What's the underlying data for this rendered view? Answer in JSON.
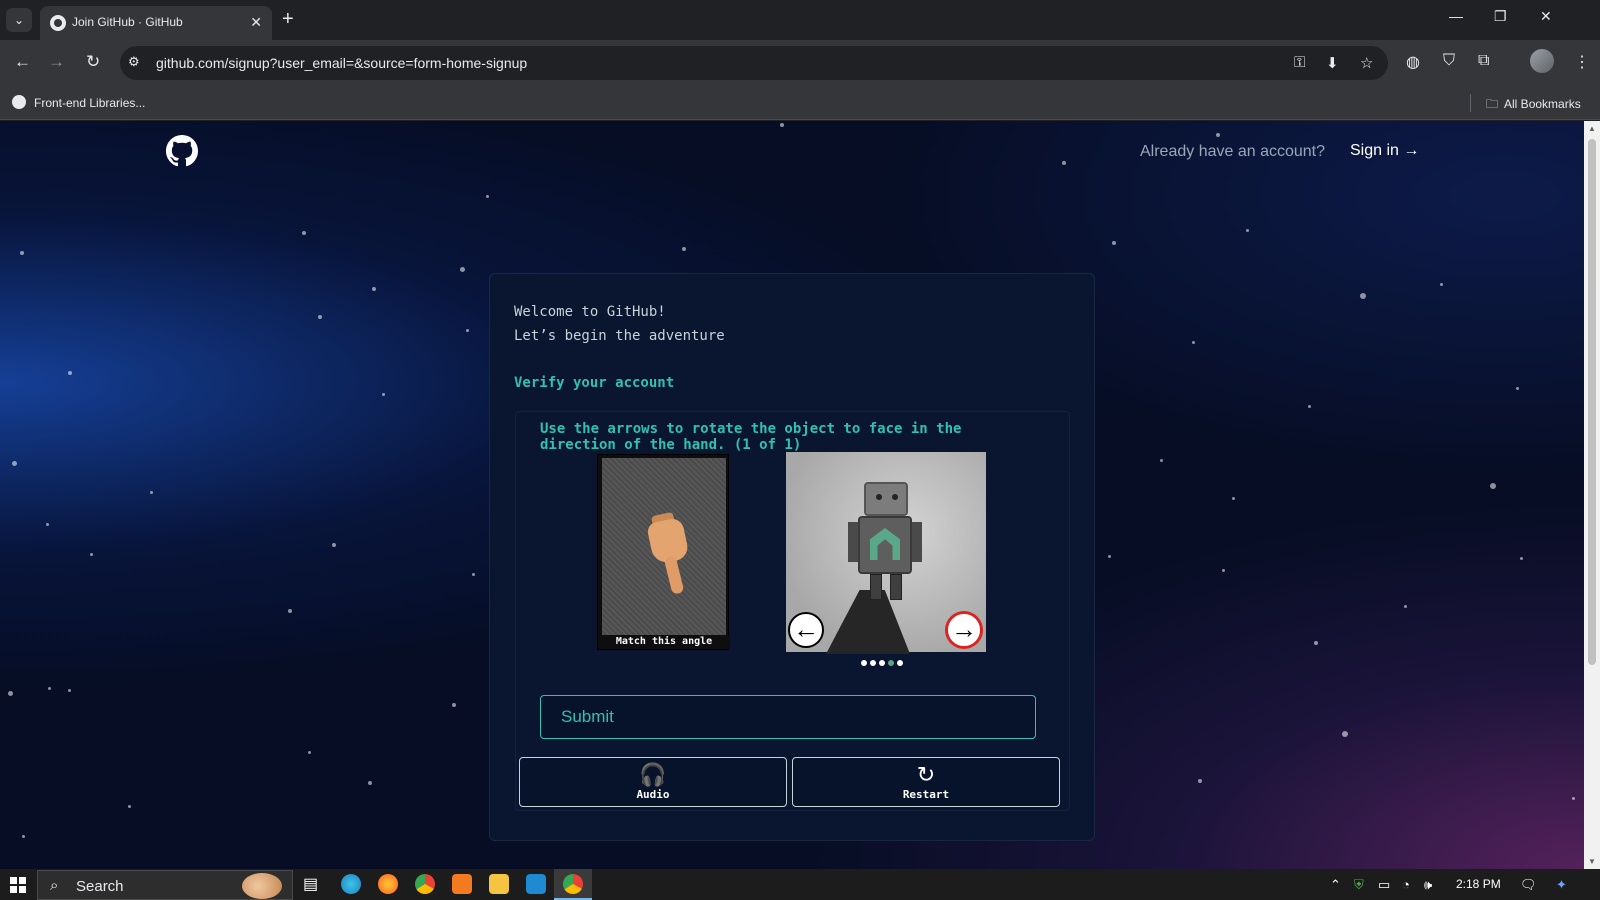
{
  "browser": {
    "tab_title": "Join GitHub · GitHub",
    "tab_list_icon": "chevron-down-icon",
    "new_tab_icon": "plus-icon",
    "url": "github.com/signup?user_email=&source=form-home-signup",
    "bookmark_item": "Front-end Libraries...",
    "all_bookmarks": "All Bookmarks",
    "window_controls": [
      "minimize-icon",
      "restore-icon",
      "close-icon"
    ]
  },
  "page": {
    "header": {
      "signin_prompt": "Already have an account?",
      "signin_link": "Sign in →"
    },
    "card": {
      "welcome": "Welcome to GitHub!",
      "adventure": "Let’s begin the adventure",
      "verify_title": "Verify your account",
      "instruction": "Use the arrows to rotate the object to face in the direction of the hand. (1 of 1)",
      "reference_label": "Match this angle",
      "arrow_left": "←",
      "arrow_right": "→",
      "dots_total": 5,
      "dots_active_index": 3,
      "submit_label": "Submit",
      "audio_label": "Audio",
      "audio_icon": "🎧",
      "restart_label": "Restart",
      "restart_icon": "↻"
    }
  },
  "taskbar": {
    "search_placeholder": "Search",
    "clock": "2:18 PM"
  },
  "colors": {
    "accent": "#2fc2b4",
    "card_bg": "#0a1530",
    "page_bg": "#060d24"
  }
}
